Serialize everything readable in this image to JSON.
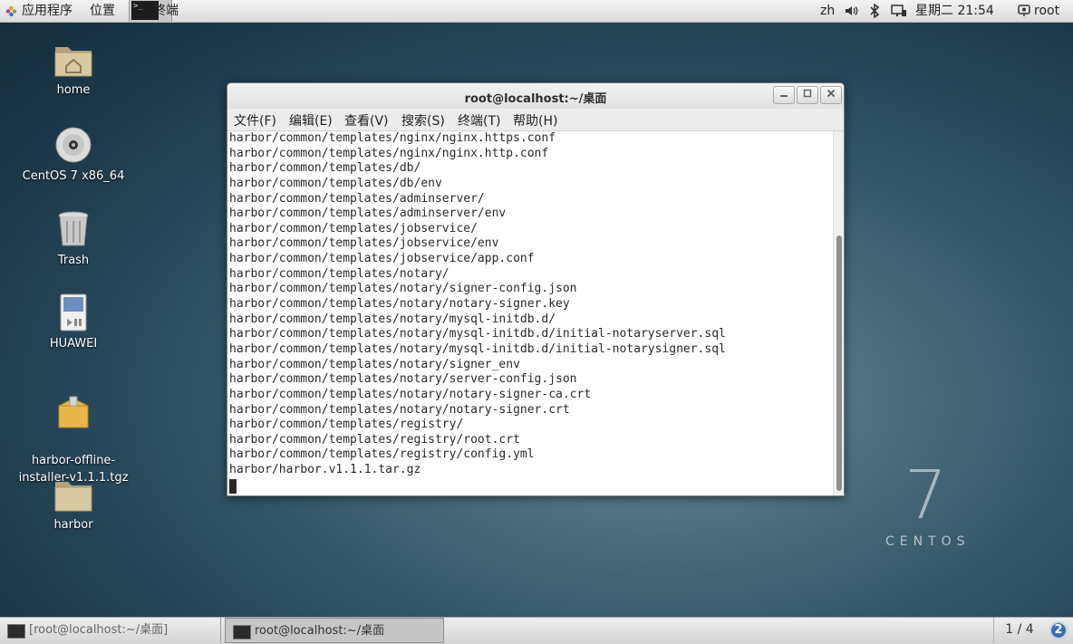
{
  "top_panel": {
    "applications": "应用程序",
    "places": "位置",
    "active_app": "终端",
    "input_method": "zh",
    "clock": "星期二 21:54",
    "user": "root"
  },
  "desktop_icons": [
    {
      "label": "home"
    },
    {
      "label": "CentOS 7 x86_64"
    },
    {
      "label": "Trash"
    },
    {
      "label": "HUAWEI"
    },
    {
      "label": "harbor-offline-\ninstaller-v1.1.1.tgz"
    },
    {
      "label": "harbor"
    }
  ],
  "branding": {
    "number": "7",
    "name": "CENTOS"
  },
  "terminal": {
    "title": "root@localhost:~/桌面",
    "menu": [
      "文件(F)",
      "编辑(E)",
      "查看(V)",
      "搜索(S)",
      "终端(T)",
      "帮助(H)"
    ],
    "lines": [
      "harbor/common/templates/nginx/nginx.https.conf",
      "harbor/common/templates/nginx/nginx.http.conf",
      "harbor/common/templates/db/",
      "harbor/common/templates/db/env",
      "harbor/common/templates/adminserver/",
      "harbor/common/templates/adminserver/env",
      "harbor/common/templates/jobservice/",
      "harbor/common/templates/jobservice/env",
      "harbor/common/templates/jobservice/app.conf",
      "harbor/common/templates/notary/",
      "harbor/common/templates/notary/signer-config.json",
      "harbor/common/templates/notary/notary-signer.key",
      "harbor/common/templates/notary/mysql-initdb.d/",
      "harbor/common/templates/notary/mysql-initdb.d/initial-notaryserver.sql",
      "harbor/common/templates/notary/mysql-initdb.d/initial-notarysigner.sql",
      "harbor/common/templates/notary/signer_env",
      "harbor/common/templates/notary/server-config.json",
      "harbor/common/templates/notary/notary-signer-ca.crt",
      "harbor/common/templates/notary/notary-signer.crt",
      "harbor/common/templates/registry/",
      "harbor/common/templates/registry/root.crt",
      "harbor/common/templates/registry/config.yml",
      "harbor/harbor.v1.1.1.tar.gz"
    ]
  },
  "taskbar": {
    "tasks": [
      {
        "label": "[root@localhost:~/桌面]"
      },
      {
        "label": "root@localhost:~/桌面"
      }
    ],
    "workspace": "1 / 4",
    "help": "2"
  }
}
